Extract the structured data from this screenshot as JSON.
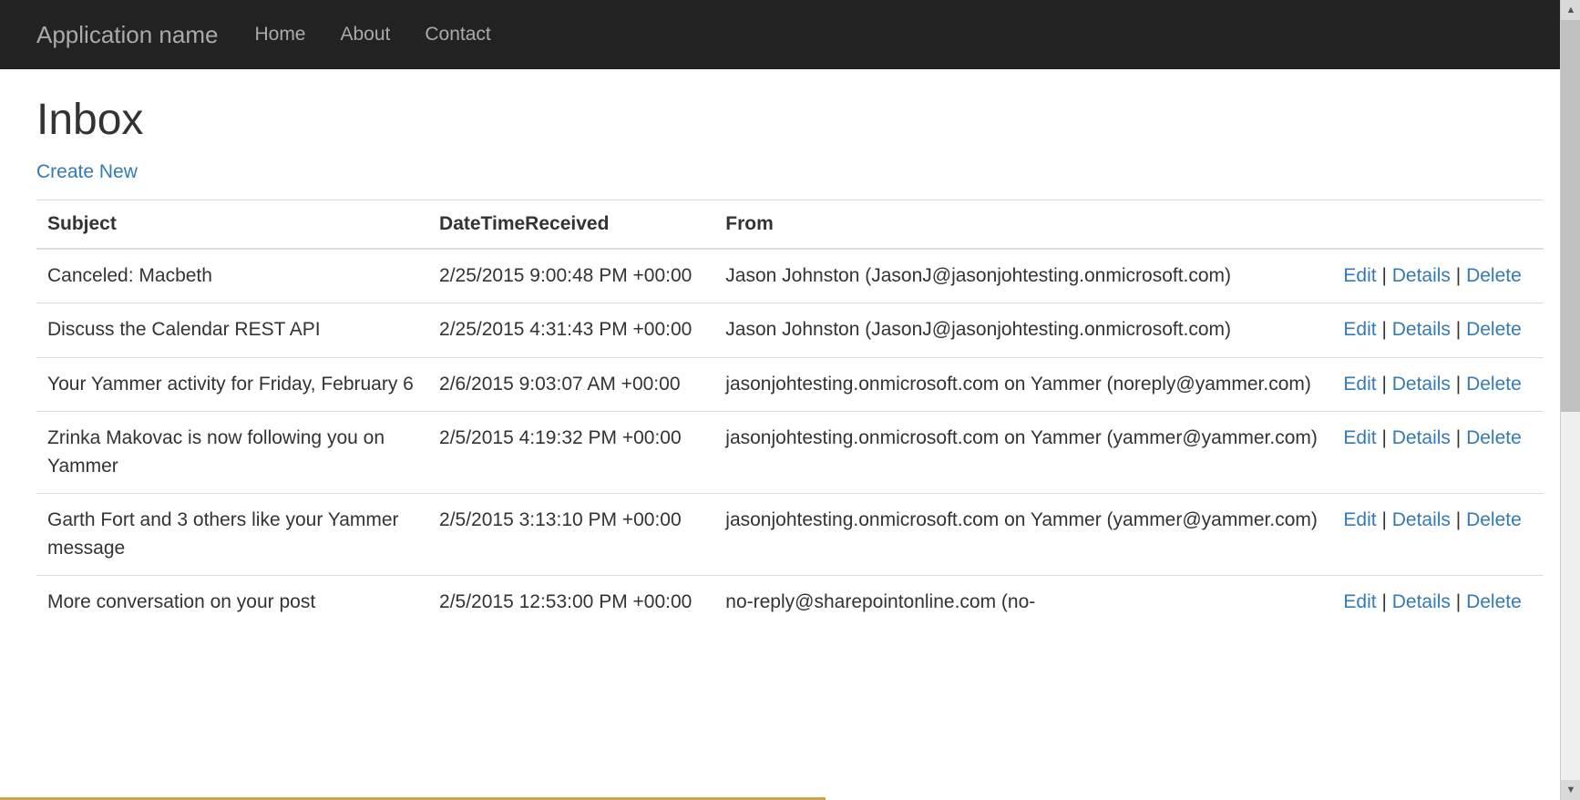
{
  "navbar": {
    "brand": "Application name",
    "links": [
      {
        "label": "Home"
      },
      {
        "label": "About"
      },
      {
        "label": "Contact"
      }
    ]
  },
  "page": {
    "title": "Inbox",
    "create_label": "Create New"
  },
  "table": {
    "headers": {
      "subject": "Subject",
      "date": "DateTimeReceived",
      "from": "From"
    },
    "rows": [
      {
        "subject": "Canceled: Macbeth",
        "date": "2/25/2015 9:00:48 PM +00:00",
        "from": "Jason Johnston (JasonJ@jasonjohtesting.onmicrosoft.com)"
      },
      {
        "subject": "Discuss the Calendar REST API",
        "date": "2/25/2015 4:31:43 PM +00:00",
        "from": "Jason Johnston (JasonJ@jasonjohtesting.onmicrosoft.com)"
      },
      {
        "subject": "Your Yammer activity for Friday, February 6",
        "date": "2/6/2015 9:03:07 AM +00:00",
        "from": "jasonjohtesting.onmicrosoft.com on Yammer (noreply@yammer.com)"
      },
      {
        "subject": "Zrinka Makovac is now following you on Yammer",
        "date": "2/5/2015 4:19:32 PM +00:00",
        "from": "jasonjohtesting.onmicrosoft.com on Yammer (yammer@yammer.com)"
      },
      {
        "subject": "Garth Fort and 3 others like your Yammer message",
        "date": "2/5/2015 3:13:10 PM +00:00",
        "from": "jasonjohtesting.onmicrosoft.com on Yammer (yammer@yammer.com)"
      },
      {
        "subject": "More conversation on your post",
        "date": "2/5/2015 12:53:00 PM +00:00",
        "from": "no-reply@sharepointonline.com (no-"
      }
    ],
    "actions": {
      "edit": "Edit",
      "details": "Details",
      "delete": "Delete"
    }
  }
}
